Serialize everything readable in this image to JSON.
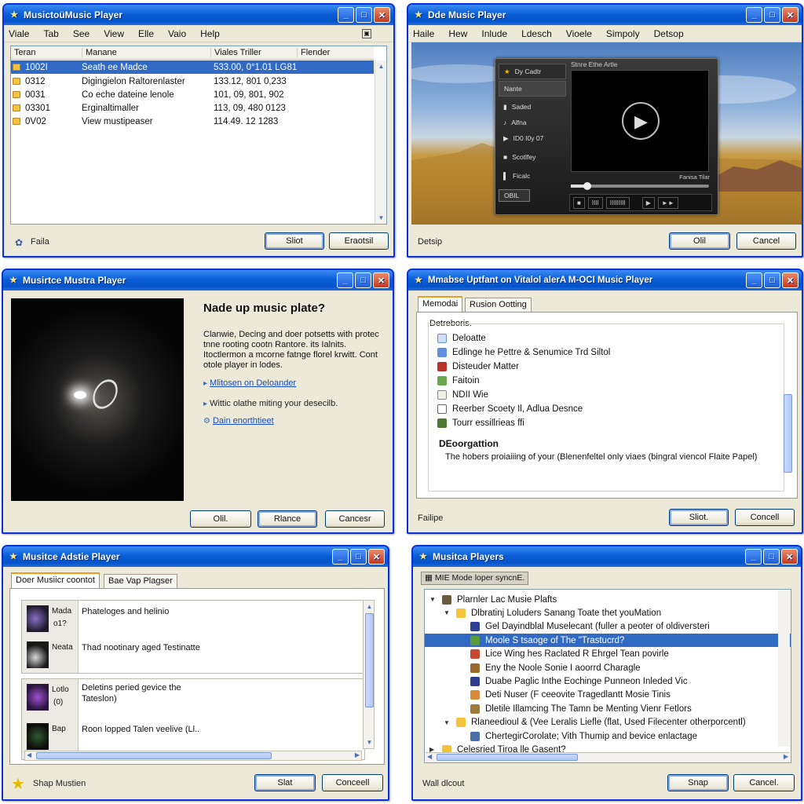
{
  "w1": {
    "title": "MusictoüMusic Player",
    "menu": [
      "Viale",
      "Tab",
      "See",
      "View",
      "Elle",
      "Vaio",
      "Help"
    ],
    "columns": [
      "Teran",
      "Manane",
      "Viales Triller",
      "Flender"
    ],
    "rows": [
      {
        "c1": "1002I",
        "c2": "Seath ee Madce",
        "c3": "533.00, 0°1.01 LG81"
      },
      {
        "c1": "0312",
        "c2": "Digingielon Raltorenlaster",
        "c3": "133.12, 801 0,233"
      },
      {
        "c1": "0031",
        "c2": "Co eche dateine lenole",
        "c3": "101, 09, 801, 902"
      },
      {
        "c1": "03301",
        "c2": "Erginaltimaller",
        "c3": "113, 09, 480 0123"
      },
      {
        "c1": "0V02",
        "c2": "View mustipeaser",
        "c3": "114.49. 12 1283"
      }
    ],
    "status": "Faila",
    "btn_ok": "Sliot",
    "btn_cancel": "Eraotsil"
  },
  "w2": {
    "title": "Dde Music Player",
    "menu": [
      "Haile",
      "Hew",
      "Inlude",
      "Ldesch",
      "Vioele",
      "Simpoly",
      "Detsop"
    ],
    "player_title": "Stnre Ethe Artle",
    "side": [
      "Dy Cadtr",
      "Nante",
      "Saded",
      "Alfna",
      "ID0 I0y 07",
      "Scotlfey",
      "Ficalc",
      "OBIL"
    ],
    "time": "Fanisa Tilar",
    "transport": [
      "IIII",
      "IIIIIIIII"
    ],
    "status": "Detsip",
    "btn_ok": "Olil",
    "btn_cancel": "Cancel"
  },
  "w3": {
    "title": "Musirtce Mustra Player",
    "heading": "Nade up music plate?",
    "body": "Clanwie, Decing and doer potsetts with protec tnne rooting cootn Rantore. its Ialnits. Itoctlermon a mcorne fatnge florel krwitt. Cont otole player in lodes.",
    "links": [
      "Mlitosen on Deloander",
      "Wittic olathe miting your desecilb.",
      "Dain enorthtieet"
    ],
    "btn_1": "Olil.",
    "btn_2": "Rlance",
    "btn_3": "Cancesr"
  },
  "w4": {
    "title": "Mmabse Uptfant on Vitalol alerA M-OCI Music Player",
    "tabs": [
      "Memodai",
      "Rusion Ootting"
    ],
    "group": "Detreboris.",
    "items": [
      "Deloatte",
      "Edlinge he Pettre & Senumice Trd Siltol",
      "Disteuder Matter",
      "Faitoin",
      "NDII Wie",
      "Reerber Scoety Il, Adlua Desnce",
      "Tourr essillrieas ffi"
    ],
    "section": "DEoorgattion",
    "desc": "The hobers proiaiiing of your (Blenenfeltel only viaes (bingral viencol Flaite Papel)",
    "status": "Failipe",
    "btn_ok": "Sliot.",
    "btn_cancel": "Concell"
  },
  "w5": {
    "title": "Musitce Adstie Player",
    "tabs": [
      "Doer Musiicr coontot",
      "Bae Vap Plagser"
    ],
    "cards": [
      {
        "t1": "Mada",
        "t2": "o1?",
        "text": "Phateloges and helinio"
      },
      {
        "t1": "Neata",
        "t2": "",
        "text": "Thad nootinary aged Testinatte"
      },
      {
        "t1": "Lotlo",
        "t2": "(0)",
        "text": "Deletins peried gevice the Tateslon)"
      },
      {
        "t1": "Bap",
        "t2": "",
        "text": "Roon lopped Talen veelive (Ll.."
      }
    ],
    "status": "Shap Mustien",
    "btn_ok": "Slat",
    "btn_cancel": "Conceell"
  },
  "w6": {
    "title": "Musitca Players",
    "combo": "MIE Mode loper syncnE.",
    "tree": [
      {
        "level": 0,
        "text": "Plarnler Lac Musie Plafts",
        "toggle": "▼"
      },
      {
        "level": 1,
        "text": "Dlbratinj Loluders Sanang Toate thet youMation",
        "toggle": "▼"
      },
      {
        "level": 2,
        "text": "Gel Dayindblal Muselecant (fuller a peoter of oldiversteri",
        "toggle": ""
      },
      {
        "level": 2,
        "text": "Moole S tsaoge of The \"Trastucrd?",
        "toggle": "",
        "selected": true
      },
      {
        "level": 2,
        "text": "Lice Wing hes Raclated R Ehrgel Tean povirle",
        "toggle": ""
      },
      {
        "level": 2,
        "text": "Eny the Noole Sonie I aoorrd Charagle",
        "toggle": ""
      },
      {
        "level": 2,
        "text": "Duabe Paglic Inthe Eochinge Punneon Inleded Vic",
        "toggle": ""
      },
      {
        "level": 2,
        "text": "Deti Nuser (F ceeovite Tragedlantt Mosie Tinis",
        "toggle": ""
      },
      {
        "level": 2,
        "text": "Dletile Illamcing The Tamn be Menting Vienr Fetlors",
        "toggle": ""
      },
      {
        "level": 1,
        "text": "Rlaneedioul & (Vee Leralis Liefle (flat, Used Filecenter otherporcentl)",
        "toggle": "▼"
      },
      {
        "level": 2,
        "text": "ChertegirCorolate; Vith Thumip and bevice enlactage",
        "toggle": ""
      },
      {
        "level": 0,
        "text": "Celesried Tiroa lle Gasent?",
        "toggle": "▶"
      }
    ],
    "status": "Wall dlcout",
    "btn_ok": "Snap",
    "btn_cancel": "Cancel."
  },
  "colors": {
    "titlebar": "#0a5fd6",
    "selection": "#316ac5",
    "window_bg": "#ece9d8"
  }
}
